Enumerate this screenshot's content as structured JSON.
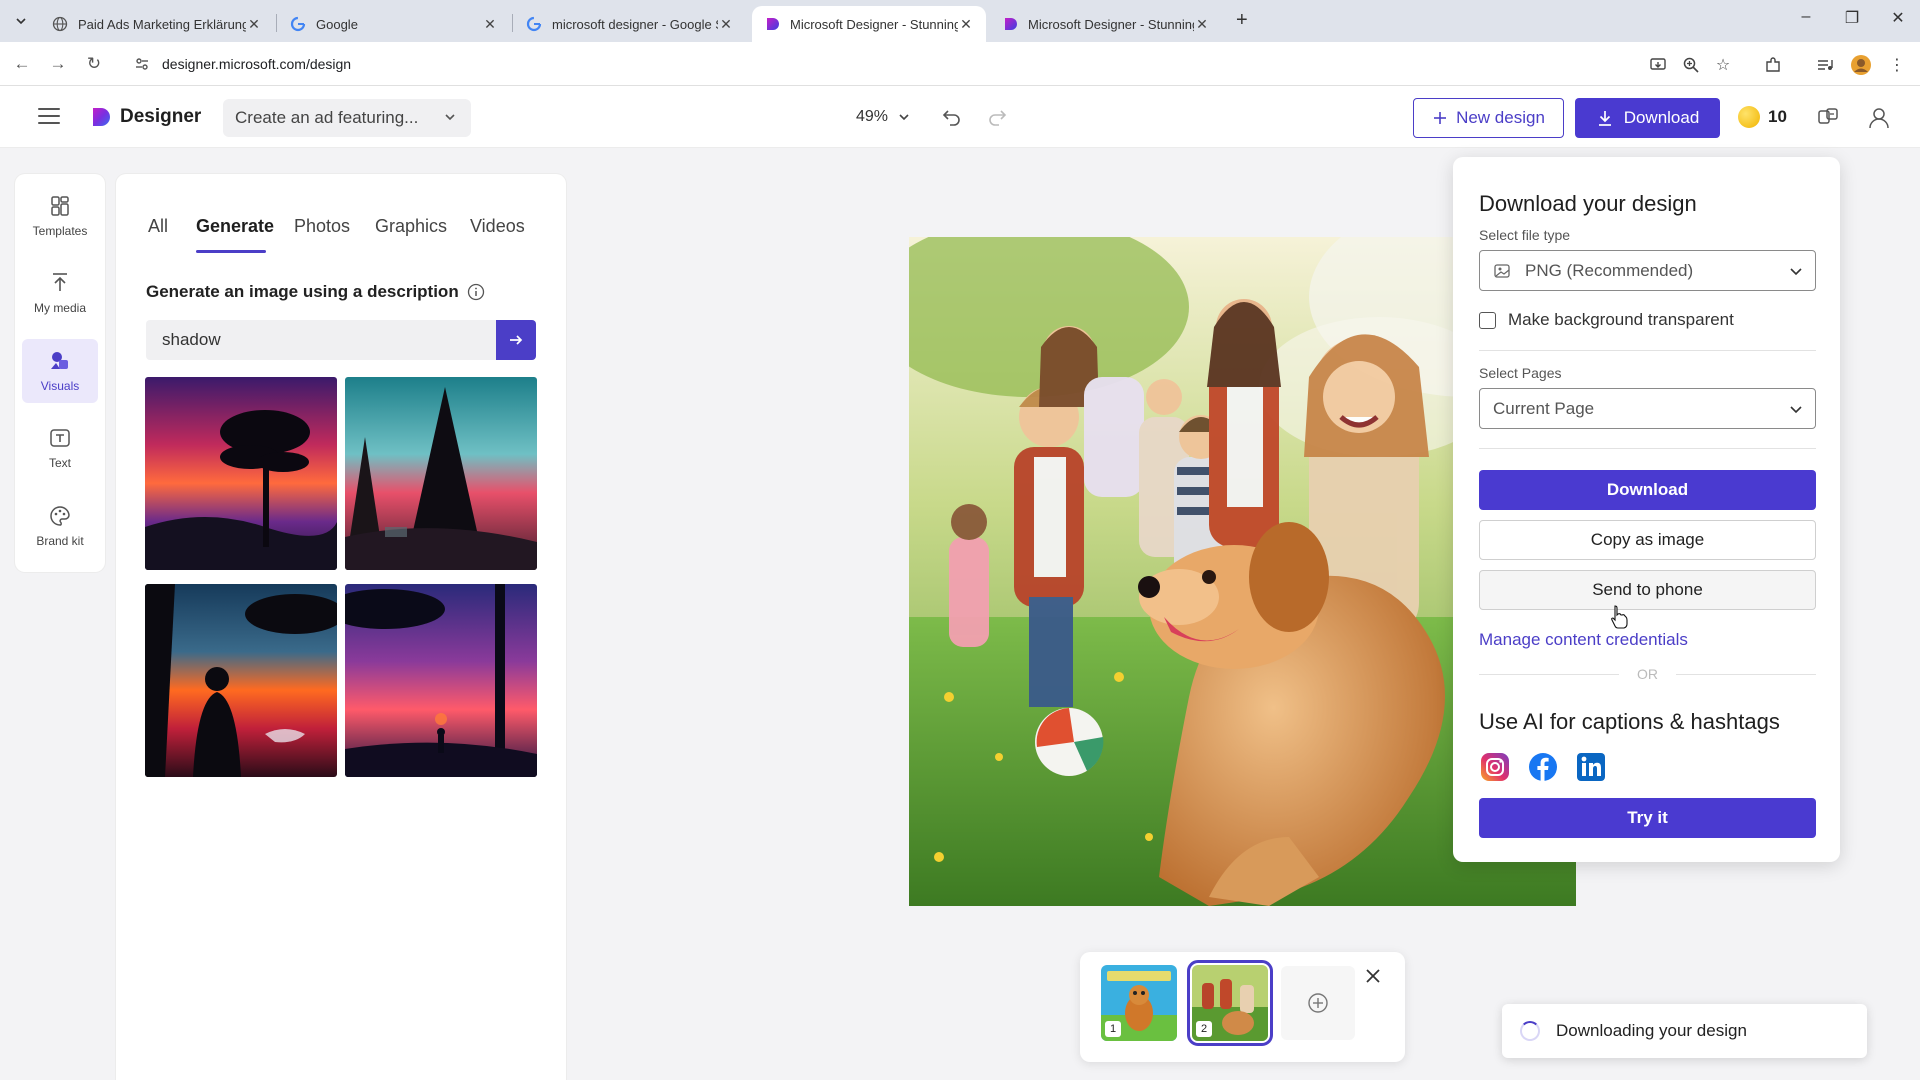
{
  "browser": {
    "tabs": [
      {
        "label": "Paid Ads Marketing Erklärung",
        "icon": "globe-icon"
      },
      {
        "label": "Google",
        "icon": "google-icon"
      },
      {
        "label": "microsoft designer - Google Se",
        "icon": "google-icon"
      },
      {
        "label": "Microsoft Designer - Stunning",
        "icon": "designer-icon",
        "active": true
      },
      {
        "label": "Microsoft Designer - Stunning",
        "icon": "designer-icon"
      }
    ],
    "url": "designer.microsoft.com/design"
  },
  "header": {
    "app_name": "Designer",
    "prompt_dropdown": "Create an ad featuring...",
    "zoom": "49%",
    "new_design_label": "New design",
    "download_label": "Download",
    "credits": "10"
  },
  "rail": {
    "items": [
      {
        "label": "Templates",
        "icon": "templates-icon"
      },
      {
        "label": "My media",
        "icon": "upload-icon"
      },
      {
        "label": "Visuals",
        "icon": "visuals-icon",
        "active": true
      },
      {
        "label": "Text",
        "icon": "text-icon"
      },
      {
        "label": "Brand kit",
        "icon": "palette-icon"
      }
    ]
  },
  "panel": {
    "tabs": [
      "All",
      "Generate",
      "Photos",
      "Graphics",
      "Videos"
    ],
    "active_tab": "Generate",
    "generate_label": "Generate an image using a description",
    "prompt_value": "shadow",
    "results_count": 4
  },
  "popup": {
    "title": "Download your design",
    "file_type_label": "Select file type",
    "file_type_value": "PNG (Recommended)",
    "transparent_label": "Make background transparent",
    "transparent_checked": false,
    "pages_label": "Select Pages",
    "pages_value": "Current Page",
    "download_button": "Download",
    "copy_button": "Copy as image",
    "send_button": "Send to phone",
    "credentials_link": "Manage content credentials",
    "or_label": "OR",
    "ai_title": "Use AI for captions & hashtags",
    "social": [
      "instagram-icon",
      "facebook-icon",
      "linkedin-icon"
    ],
    "try_button": "Try it"
  },
  "pages": {
    "items": [
      {
        "number": "1",
        "selected": false
      },
      {
        "number": "2",
        "selected": true
      }
    ]
  },
  "toast": {
    "message": "Downloading your design"
  },
  "colors": {
    "accent": "#4b3ec7",
    "button_primary": "#4a3ad0",
    "rail_active_bg": "#ebe8fb"
  }
}
